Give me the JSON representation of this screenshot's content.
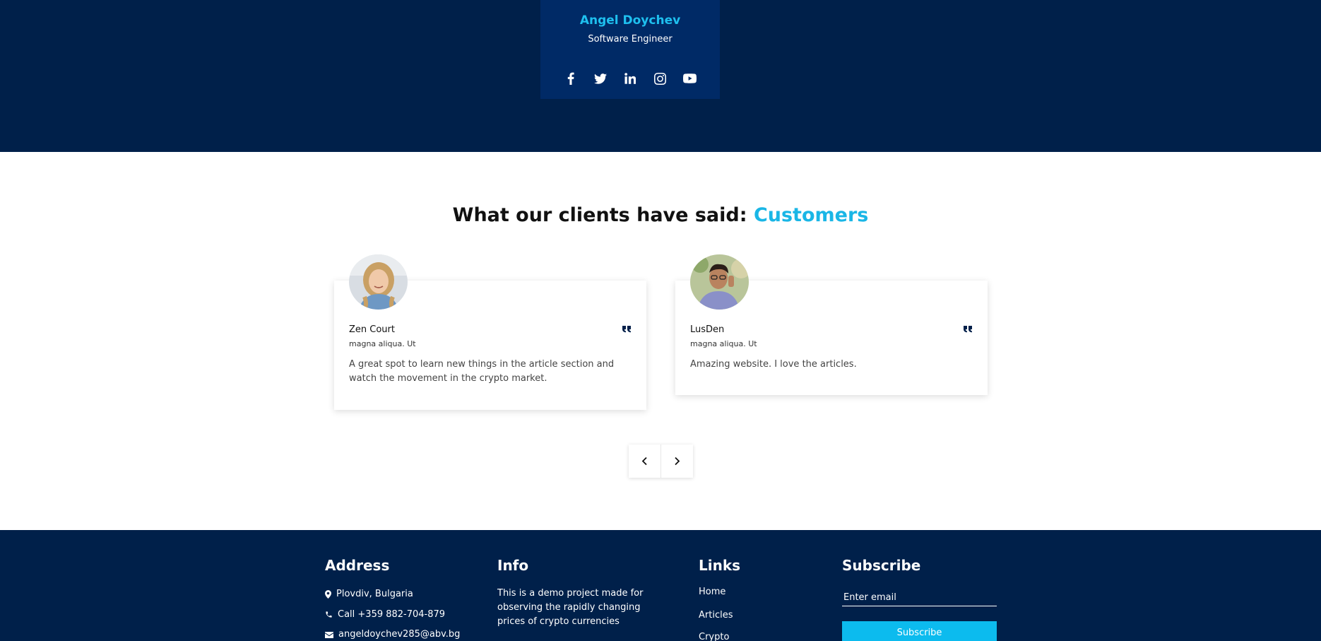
{
  "team": {
    "name": "Angel Doychev",
    "role": "Software Engineer",
    "socials": [
      "facebook-icon",
      "twitter-icon",
      "linkedin-icon",
      "instagram-icon",
      "youtube-icon"
    ]
  },
  "testimonials": {
    "title_main": "What our clients have said:",
    "title_accent": "Customers",
    "cards": [
      {
        "name": "Zen Court",
        "subtitle": "magna aliqua. Ut",
        "text": "A great spot to learn new things in the article section and watch the movement in the crypto market."
      },
      {
        "name": "LusDen",
        "subtitle": "magna aliqua. Ut",
        "text": "Amazing website. I love the articles."
      }
    ]
  },
  "footer": {
    "address": {
      "title": "Address",
      "location": "Plovdiv, Bulgaria",
      "phone": "Call +359 882-704-879",
      "email": "angeldoychev285@abv.bg"
    },
    "info": {
      "title": "Info",
      "text": "This is a demo project made for observing the rapidly changing prices of crypto currencies"
    },
    "links": {
      "title": "Links",
      "items": [
        "Home",
        "Articles",
        "Crypto"
      ]
    },
    "subscribe": {
      "title": "Subscribe",
      "placeholder": "Enter email",
      "button": "Subscribe"
    }
  },
  "colors": {
    "navy": "#00204a",
    "card_navy": "#002a66",
    "accent": "#1ab6e6",
    "button": "#0cbbee"
  }
}
